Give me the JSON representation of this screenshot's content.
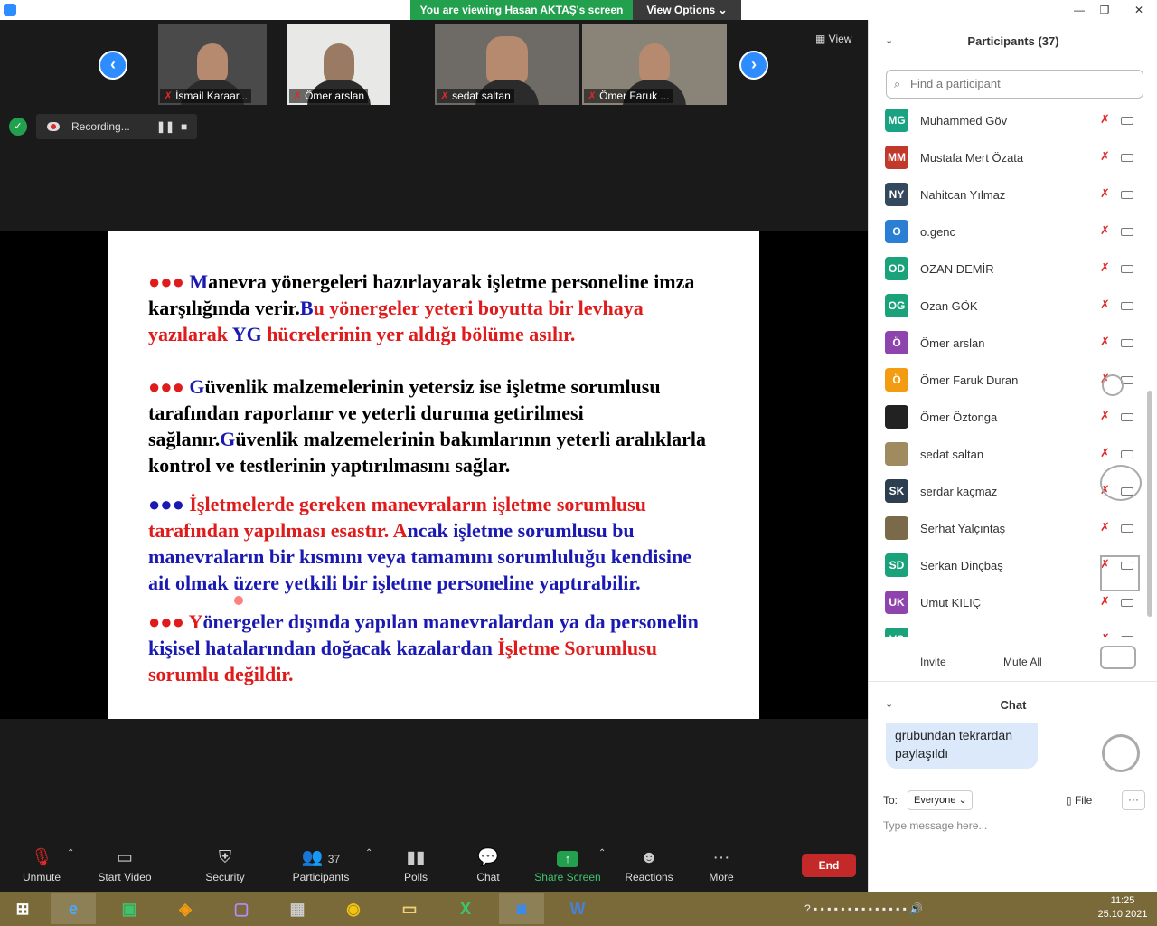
{
  "titlebar": {
    "viewing": "You are viewing Hasan AKTAŞ's screen",
    "view_options": "View Options ⌄"
  },
  "thumbnails": [
    {
      "name": "İsmail Karaar..."
    },
    {
      "name": "Ömer arslan"
    },
    {
      "name": "sedat saltan"
    },
    {
      "name": "Ömer Faruk ..."
    }
  ],
  "view_label": "View",
  "recording": "Recording...",
  "slide": {
    "p1": {
      "bullets": "●●●",
      "M": "M",
      "t1": "anevra yönergeleri hazırlayarak işletme personeline imza karşılığında verir.",
      "B": "B",
      "t2": "u yönergeler yeteri boyutta bir levhaya yazılarak ",
      "YG": "YG",
      "t3": " hücrelerinin yer aldığı bölüme asılır."
    },
    "p2": {
      "bullets": "●●●",
      "G1": "G",
      "t1": "üvenlik malzemelerinin yetersiz ise işletme sorumlusu tarafından raporlanır ve yeterli duruma getirilmesi sağlanır.",
      "G2": "G",
      "t2": "üvenlik malzemelerinin bakımlarının yeterli aralıklarla kontrol ve testlerinin yaptırılmasını sağlar."
    },
    "p3": {
      "bullets": "●●●",
      "t1": "İşletmelerde gereken manevraların işletme sorumlusu tarafından yapılması esastır. ",
      "A": "A",
      "t2": "ncak işletme sorumlusu bu manevraların bir kısmını veya tamamını sorumluluğu kendisine ait olmak üzere  yetkili bir işletme personeline yaptırabilir."
    },
    "p4": {
      "bullets": "●●●",
      "Y": "Y",
      "t1": "önergeler dışında yapılan manevralardan ya da personelin  kişisel hatalarından doğacak kazalardan ",
      "t2": "İşletme Sorumlusu sorumlu değildir."
    }
  },
  "controls": {
    "unmute": "Unmute",
    "start_video": "Start Video",
    "security": "Security",
    "participants": "Participants",
    "participants_count": "37",
    "polls": "Polls",
    "chat": "Chat",
    "share_screen": "Share Screen",
    "reactions": "Reactions",
    "more": "More",
    "end": "End"
  },
  "panel": {
    "title": "Participants (37)",
    "search_placeholder": "Find a participant",
    "participants": [
      {
        "initials": "MG",
        "name": "Muhammed Göv",
        "color": "#1aa383"
      },
      {
        "initials": "MM",
        "name": "Mustafa Mert Özata",
        "color": "#c0392b"
      },
      {
        "initials": "NY",
        "name": "Nahitcan Yılmaz",
        "color": "#34495e"
      },
      {
        "initials": "O",
        "name": "o.genc",
        "color": "#2a7fd4"
      },
      {
        "initials": "OD",
        "name": "OZAN DEMİR",
        "color": "#1aa37a"
      },
      {
        "initials": "OG",
        "name": "Ozan GÖK",
        "color": "#1aa37a"
      },
      {
        "initials": "Ö",
        "name": "Ömer arslan",
        "color": "#8e44ad"
      },
      {
        "initials": "Ö",
        "name": "Ömer Faruk Duran",
        "color": "#f39c12"
      },
      {
        "initials": "",
        "name": "Ömer Öztonga",
        "color": "#222222"
      },
      {
        "initials": "",
        "name": "sedat saltan",
        "color": "#a08a60"
      },
      {
        "initials": "SK",
        "name": "serdar kaçmaz",
        "color": "#2c3e50"
      },
      {
        "initials": "",
        "name": "Serhat Yalçıntaş",
        "color": "#7a6a4a"
      },
      {
        "initials": "SD",
        "name": "Serkan Dinçbaş",
        "color": "#1aa37a"
      },
      {
        "initials": "UK",
        "name": "Umut KILIÇ",
        "color": "#8e44ad"
      },
      {
        "initials": "VS",
        "name": "",
        "color": "#1aa37a"
      }
    ],
    "invite": "Invite",
    "mute_all": "Mute All"
  },
  "chat": {
    "title": "Chat",
    "message": "grubundan tekrardan paylaşıldı",
    "to_label": "To:",
    "to_value": "Everyone ⌄",
    "file": "File",
    "more": "···",
    "placeholder": "Type message here..."
  },
  "taskbar": {
    "time": "11:25",
    "date": "25.10.2021"
  },
  "colors": {
    "zoom_blue": "#2d8cff",
    "green": "#23a04e",
    "end_red": "#c42929",
    "mic_red": "#e02828"
  }
}
